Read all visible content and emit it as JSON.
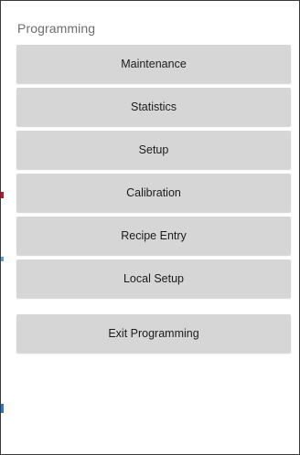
{
  "screen": {
    "title": "Programming"
  },
  "menu": {
    "items": [
      {
        "label": "Maintenance"
      },
      {
        "label": "Statistics"
      },
      {
        "label": "Setup"
      },
      {
        "label": "Calibration"
      },
      {
        "label": "Recipe Entry"
      },
      {
        "label": "Local Setup"
      }
    ],
    "exit_label": "Exit Programming"
  },
  "colors": {
    "background": "#ffffff",
    "button": "#d6d6d6",
    "title_text": "#6e6e6e",
    "button_text": "#1c1c1c"
  }
}
